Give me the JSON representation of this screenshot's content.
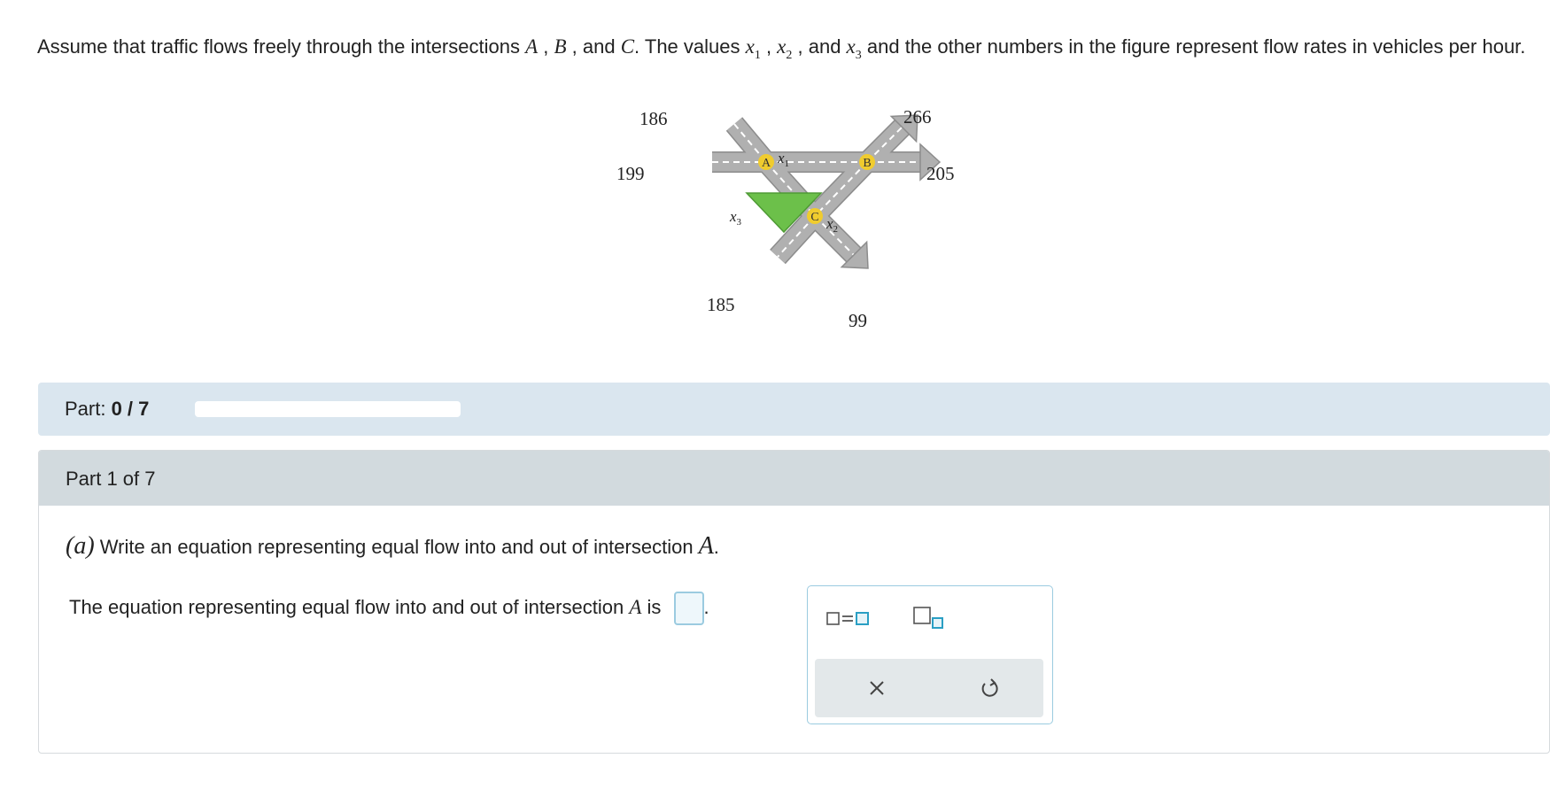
{
  "problem": {
    "t1": "Assume that traffic flows freely through the intersections ",
    "A": "A",
    "c1": " , ",
    "B": "B",
    "and1": " , and ",
    "C": "C",
    "t2": ". The values ",
    "x": "x",
    "s1": "1",
    "c2": " , ",
    "s2": "2",
    "and2": " , and ",
    "s3": "3",
    "t3": " and the other numbers in the figure represent flow rates in vehicles per hour."
  },
  "figure": {
    "flows": {
      "top_left": "186",
      "left": "199",
      "top_right": "266",
      "right": "205",
      "bottom_left": "185",
      "bottom_right": "99"
    },
    "intersections": {
      "a": "A",
      "b": "B",
      "c": "C"
    },
    "vars": {
      "x": "x",
      "s1": "1",
      "s2": "2",
      "s3": "3"
    },
    "colors": {
      "road": "#b0b0b0",
      "road_edge": "#8c8c8c",
      "lane_dash": "#ffffff",
      "triangle": "#6cc04a",
      "node": "#f0cc2e"
    }
  },
  "part_bar": {
    "label": "Part: ",
    "value": "0 / 7",
    "progress": 0
  },
  "part1": {
    "header": "Part 1 of 7",
    "q_letter": "(a)",
    "q_text": " Write an equation representing equal flow into and out of intersection ",
    "q_var": "A",
    "q_end": ".",
    "answer_prefix": "The equation representing equal flow into and out of intersection ",
    "answer_var": "A",
    "answer_is": " is ",
    "answer_end": "."
  },
  "palette": {
    "tools": [
      "equation-tool",
      "subscript-tool"
    ],
    "actions": [
      "clear",
      "undo"
    ],
    "accent": "#2a9fc4"
  }
}
